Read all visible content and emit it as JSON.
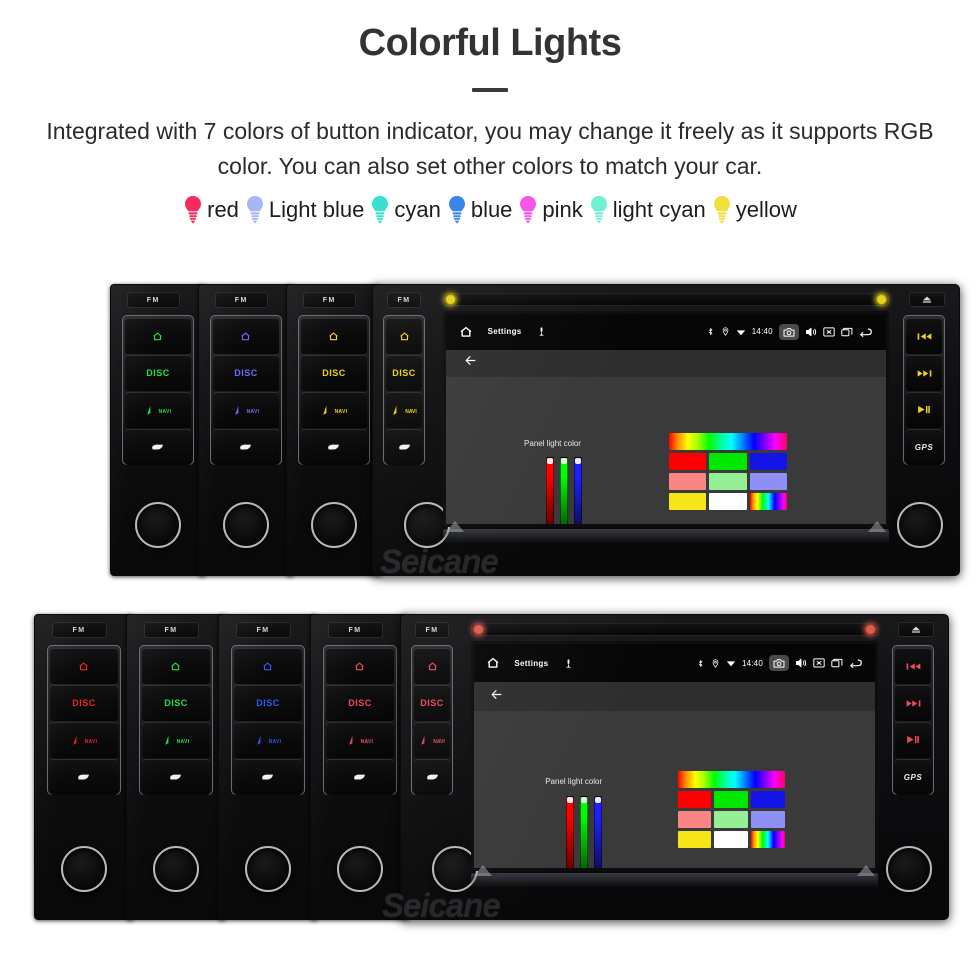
{
  "header": {
    "title": "Colorful Lights",
    "subtitle": "Integrated with 7 colors of button indicator, you may change it freely as it supports RGB color. You can also set other colors to match your car."
  },
  "legend": {
    "items": [
      {
        "label": "red",
        "color": "#f72a5e"
      },
      {
        "label": "Light blue",
        "color": "#a8b6f5"
      },
      {
        "label": "cyan",
        "color": "#39dfcf"
      },
      {
        "label": "blue",
        "color": "#3b86ea"
      },
      {
        "label": "pink",
        "color": "#f955e8"
      },
      {
        "label": "light cyan",
        "color": "#72f0d4"
      },
      {
        "label": "yellow",
        "color": "#f0df3c"
      }
    ]
  },
  "screen": {
    "statusbar": {
      "home_icon": "home-icon",
      "title": "Settings",
      "mic_icon": "microphone-icon",
      "bluetooth_icon": "bluetooth-icon",
      "location_icon": "location-icon",
      "wifi_icon": "wifi-icon",
      "time": "14:40",
      "camera_icon": "camera-icon",
      "volume_icon": "volume-icon",
      "close_icon": "close-box-icon",
      "recents_icon": "recents-icon",
      "back_icon": "back-arrow-icon"
    },
    "subbar": {
      "back_icon": "back-arrow-icon"
    },
    "body": {
      "panel_label": "Panel light color",
      "sliders": [
        {
          "name": "red-slider",
          "color": "#ff0000",
          "value": 100
        },
        {
          "name": "green-slider",
          "color": "#00ff00",
          "value": 100
        },
        {
          "name": "blue-slider",
          "color": "#2020ff",
          "value": 100
        }
      ],
      "rainbow_bar": "spectrum-gradient",
      "swatches": [
        {
          "name": "swatch-red",
          "color": "#ff0000"
        },
        {
          "name": "swatch-green",
          "color": "#00e800"
        },
        {
          "name": "swatch-blue",
          "color": "#1414e6"
        },
        {
          "name": "swatch-salmon",
          "color": "#fa8585"
        },
        {
          "name": "swatch-light-green",
          "color": "#95f095"
        },
        {
          "name": "swatch-periwinkle",
          "color": "#8f90f5"
        },
        {
          "name": "swatch-yellow",
          "color": "#f7e617"
        },
        {
          "name": "swatch-white",
          "color": "#ffffff"
        },
        {
          "name": "swatch-rainbow",
          "color": "rainbow"
        }
      ]
    }
  },
  "unit": {
    "fm_label": "FM",
    "left_buttons": [
      {
        "name": "home-button",
        "label": "",
        "icon": "home-icon"
      },
      {
        "name": "disc-button",
        "label": "DISC",
        "icon": ""
      },
      {
        "name": "navi-button",
        "label": "NAVI",
        "icon": "navi-arrow-icon"
      },
      {
        "name": "sd-button",
        "label": "",
        "icon": "sd-card-icon"
      }
    ],
    "right_buttons": [
      {
        "name": "previous-track-button",
        "icon": "previous-track-icon"
      },
      {
        "name": "next-track-button",
        "icon": "next-track-icon"
      },
      {
        "name": "play-pause-button",
        "icon": "play-pause-icon"
      },
      {
        "name": "gps-button",
        "label": "GPS",
        "icon": ""
      }
    ],
    "eject_icon": "eject-icon",
    "knob": "volume-knob"
  },
  "groups": {
    "top": {
      "led_color": "#e8d21b",
      "side_units": [
        {
          "name": "unit-green",
          "light": "#22e04a"
        },
        {
          "name": "unit-violet",
          "light": "#6a6ef5"
        },
        {
          "name": "unit-yellow",
          "light": "#f0d41a"
        }
      ],
      "main_light": "#f0d41a"
    },
    "bottom": {
      "led_color": "#e05a4e",
      "side_units": [
        {
          "name": "unit-red",
          "light": "#f02020"
        },
        {
          "name": "unit-green",
          "light": "#22e04a"
        },
        {
          "name": "unit-blue",
          "light": "#2a5cf0"
        },
        {
          "name": "unit-red-2",
          "light": "#f04a5a"
        }
      ],
      "main_light": "#f04a5a"
    }
  },
  "watermark": {
    "text": "Seicane"
  }
}
